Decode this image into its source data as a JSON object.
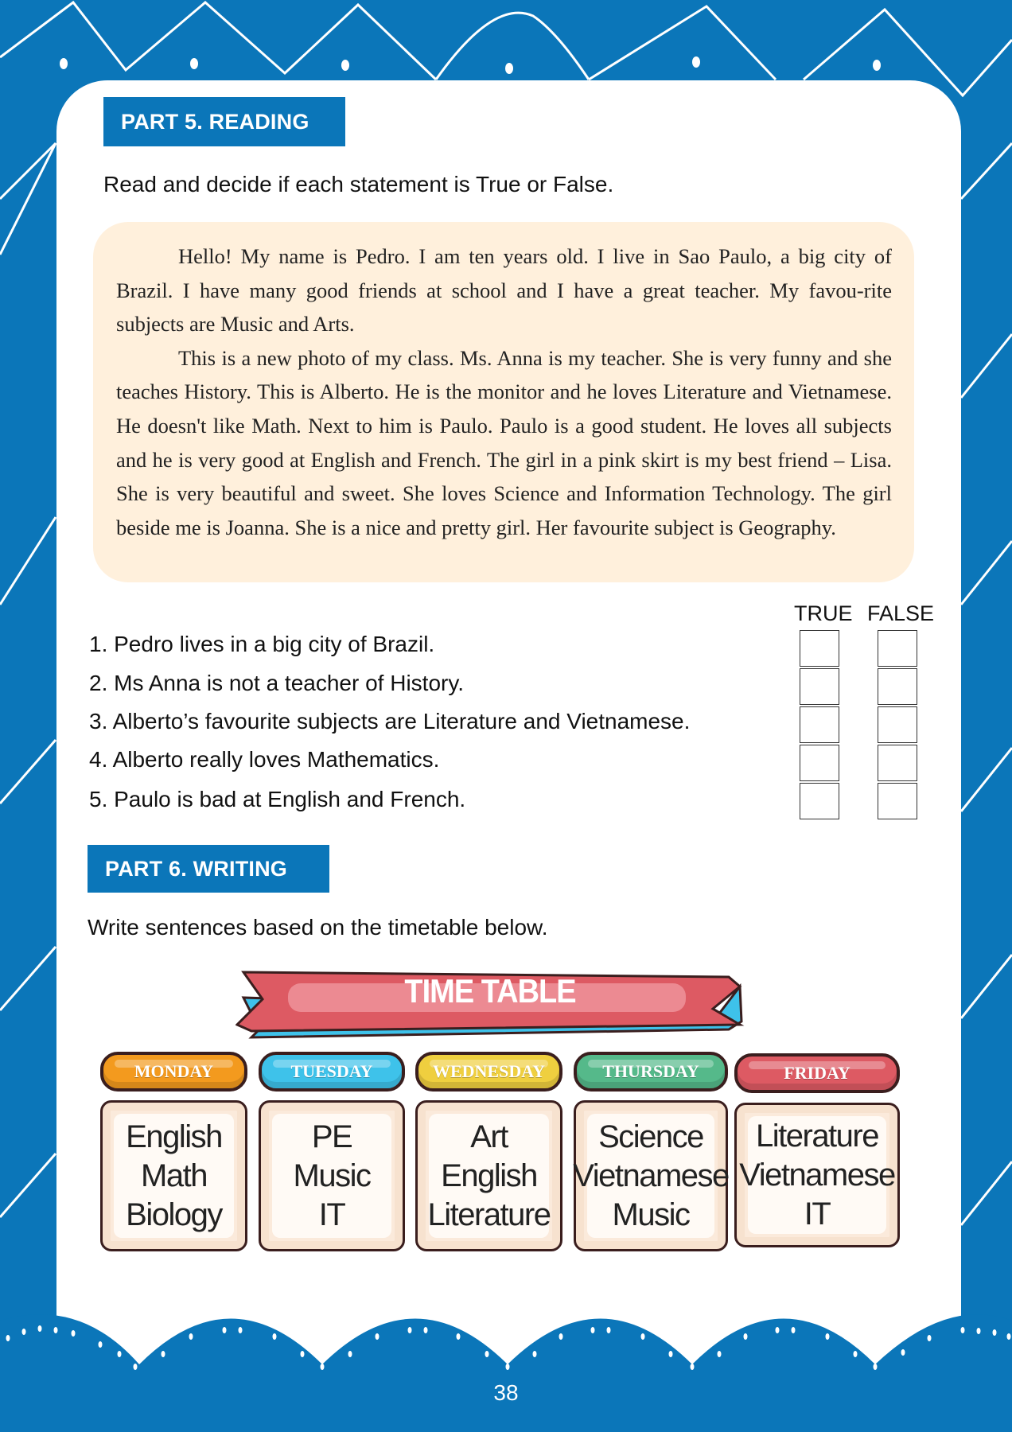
{
  "colors": {
    "brand_blue": "#0b76b9",
    "passage_bg": "#fff0dc",
    "monday": "#f39a1e",
    "tuesday": "#3ec2ea",
    "wednesday": "#efcf3f",
    "thursday": "#55b98a",
    "friday": "#dd5a63"
  },
  "part5": {
    "title": "PART 5. READING",
    "instruction": "Read and decide if each statement is True or False.",
    "passage": [
      "Hello! My name is Pedro. I am ten years old. I live in Sao Paulo, a big city of Brazil. I have many good friends at school and I have a great teacher. My favou-rite subjects are Music and Arts.",
      "This is a new photo of my class. Ms. Anna is my teacher. She is very funny and she teaches History. This is Alberto. He is the monitor and he loves Literature and Vietnamese. He doesn't like Math. Next to him is Paulo. Paulo is a good student. He loves all subjects and he is very good at English and French. The girl in a pink skirt is my best friend – Lisa. She is very beautiful and sweet. She loves Science and Information Technology. The girl beside me is Joanna. She is a nice and pretty girl. Her favourite subject is Geography."
    ],
    "true_label": "TRUE",
    "false_label": "FALSE",
    "statements": [
      "1. Pedro lives in a big city of Brazil.",
      "2. Ms Anna is not a teacher of History.",
      "3. Alberto’s favourite subjects are Literature and Vietnamese.",
      "4. Alberto really loves Mathematics.",
      "5. Paulo is bad at English and French."
    ]
  },
  "part6": {
    "title": "PART 6. WRITING",
    "instruction": "Write sentences based on the timetable below.",
    "timetable_title": "TIME TABLE",
    "days": [
      {
        "day": "MONDAY",
        "subjects": [
          "English",
          "Math",
          "Biology"
        ]
      },
      {
        "day": "TUESDAY",
        "subjects": [
          "PE",
          "Music",
          "IT"
        ]
      },
      {
        "day": "WEDNESDAY",
        "subjects": [
          "Art",
          "English",
          "Literature"
        ]
      },
      {
        "day": "THURSDAY",
        "subjects": [
          "Science",
          "Vietnamese",
          "Music"
        ]
      },
      {
        "day": "FRIDAY",
        "subjects": [
          "Literature",
          "Vietnamese",
          "IT"
        ]
      }
    ]
  },
  "page_number": "38"
}
